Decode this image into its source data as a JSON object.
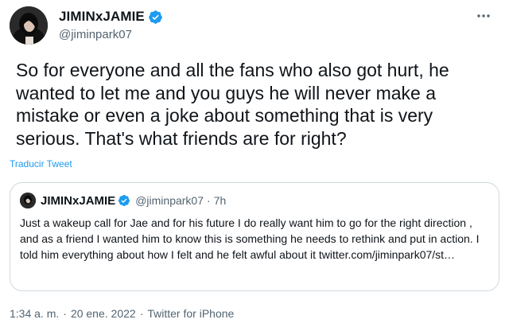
{
  "author": {
    "display_name": "JIMINxJAMIE",
    "handle": "@jiminpark07"
  },
  "tweet": {
    "text": "So for everyone and all the fans who also got hurt, he wanted to let me and you guys he will never make a mistake or even a joke about something that is very serious. That's what friends are for right?",
    "translate_label": "Traducir Tweet"
  },
  "quoted": {
    "display_name": "JIMINxJAMIE",
    "handle": "@jiminpark07",
    "dot": "·",
    "time": "7h",
    "text": "Just a wakeup call for Jae and for his future I do really want him to go for the right direction , and as a friend I wanted him to know this is something he needs to rethink and put in action. I told him everything about how I felt and he felt awful about it twitter.com/jiminpark07/st…"
  },
  "meta": {
    "time": "1:34 a. m.",
    "sep1": "·",
    "date": "20 ene. 2022",
    "sep2": "·",
    "source": "Twitter for iPhone"
  },
  "colors": {
    "verified": "#1d9bf0",
    "link": "#1d9bf0",
    "secondary_text": "#536471",
    "border": "#cfd9de"
  },
  "icons": {
    "verified": "verified-badge-icon",
    "more": "more-horizontal-icon"
  }
}
